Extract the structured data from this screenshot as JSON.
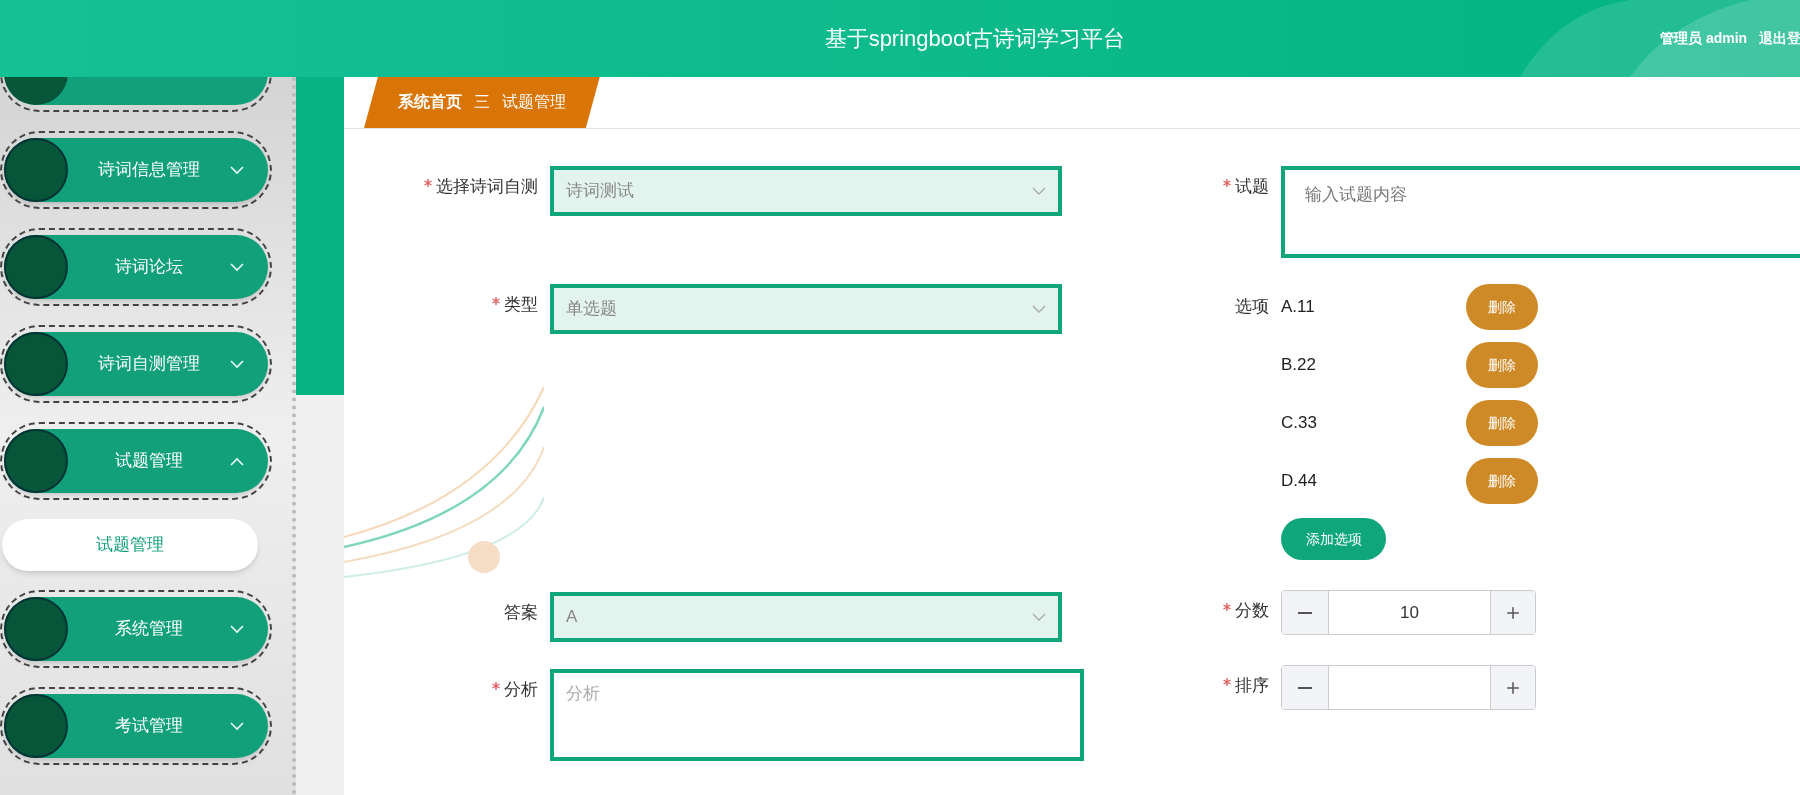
{
  "header": {
    "title": "基于springboot古诗词学习平台",
    "user": "管理员 admin",
    "logout": "退出登"
  },
  "sidebar": {
    "items": [
      {
        "label": "诗词信息管理",
        "expanded": false
      },
      {
        "label": "诗词论坛",
        "expanded": false
      },
      {
        "label": "诗词自测管理",
        "expanded": false
      },
      {
        "label": "试题管理",
        "expanded": true,
        "children": [
          {
            "label": "试题管理",
            "selected": true
          }
        ]
      },
      {
        "label": "系统管理",
        "expanded": false
      },
      {
        "label": "考试管理",
        "expanded": false
      }
    ]
  },
  "breadcrumb": {
    "items": [
      "系统首页",
      "试题管理"
    ],
    "separator": "三"
  },
  "form": {
    "left": [
      {
        "kind": "select",
        "label": "选择诗词自测",
        "required": true,
        "value": "诗词测试"
      },
      {
        "kind": "select",
        "label": "类型",
        "required": true,
        "value": "单选题"
      },
      {
        "kind": "select",
        "label": "答案",
        "required": false,
        "value": "A"
      },
      {
        "kind": "textarea",
        "label": "分析",
        "required": true,
        "placeholder": "分析"
      }
    ],
    "question": {
      "label": "试题",
      "required": true,
      "placeholder": "输入试题内容"
    },
    "options": {
      "label": "选项",
      "items": [
        {
          "text": "A.11",
          "delete": "删除"
        },
        {
          "text": "B.22",
          "delete": "删除"
        },
        {
          "text": "C.33",
          "delete": "删除"
        },
        {
          "text": "D.44",
          "delete": "删除"
        }
      ],
      "add": "添加选项"
    },
    "numbers": [
      {
        "label": "分数",
        "required": true,
        "value": "10"
      },
      {
        "label": "排序",
        "required": true
      }
    ]
  }
}
